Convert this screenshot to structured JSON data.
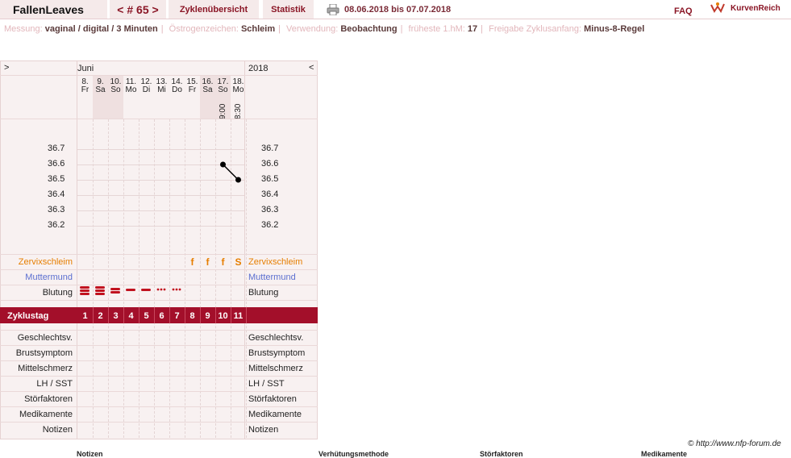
{
  "header": {
    "brand": "FallenLeaves",
    "cycle": "< # 65 >",
    "tab_overview": "Zyklenübersicht",
    "tab_stats": "Statistik",
    "date_range": "08.06.2018 bis 07.07.2018",
    "faq": "FAQ",
    "logo_text": "KurvenReich"
  },
  "meta": {
    "messung_label": "Messung:",
    "messung_value": "vaginal / digital / 3 Minuten",
    "oestrogen_label": "Östrogenzeichen:",
    "oestrogen_value": "Schleim",
    "verwendung_label": "Verwendung:",
    "verwendung_value": "Beobachtung",
    "frueheste_label": "früheste 1.hM:",
    "frueheste_value": "17",
    "freigabe_label": "Freigabe Zyklusanfang:",
    "freigabe_value": "Minus-8-Regel"
  },
  "chart_head": {
    "left_arrow": ">",
    "right_arrow": "<",
    "month": "Juni",
    "year": "2018"
  },
  "days": [
    {
      "num": "8.",
      "wd": "Fr"
    },
    {
      "num": "9.",
      "wd": "Sa"
    },
    {
      "num": "10.",
      "wd": "So"
    },
    {
      "num": "11.",
      "wd": "Mo"
    },
    {
      "num": "12.",
      "wd": "Di"
    },
    {
      "num": "13.",
      "wd": "Mi"
    },
    {
      "num": "14.",
      "wd": "Do"
    },
    {
      "num": "15.",
      "wd": "Fr"
    },
    {
      "num": "16.",
      "wd": "Sa"
    },
    {
      "num": "17.",
      "wd": "So"
    },
    {
      "num": "18.",
      "wd": "Mo"
    }
  ],
  "times": [
    {
      "day": "17.",
      "value": "9:00"
    },
    {
      "day": "18.",
      "value": "8:30"
    }
  ],
  "temperature_scale": [
    "36.7",
    "36.6",
    "36.5",
    "36.4",
    "36.3",
    "36.2"
  ],
  "chart_data": {
    "type": "line",
    "x": [
      "17.",
      "18."
    ],
    "series": [
      {
        "values": [
          36.6,
          36.5
        ]
      }
    ],
    "ylim": [
      36.2,
      36.7
    ]
  },
  "rows": {
    "zervix": "Zervixschleim",
    "muttermund": "Muttermund",
    "blutung": "Blutung",
    "zyklustag": "Zyklustag",
    "geschlechtsv": "Geschlechtsv.",
    "brustsymptom": "Brustsymptom",
    "mittelschmerz": "Mittelschmerz",
    "lh": "LH / SST",
    "stoerfaktoren": "Störfaktoren",
    "medikamente": "Medikamente",
    "notizen": "Notizen"
  },
  "zervix_marks": [
    "f",
    "f",
    "f",
    "S"
  ],
  "zyklustage": [
    "1",
    "2",
    "3",
    "4",
    "5",
    "6",
    "7",
    "8",
    "9",
    "10",
    "11"
  ],
  "footer": "© http://www.nfp-forum.de",
  "bottom_headings": [
    "Notizen",
    "Verhütungsmethode",
    "Störfaktoren",
    "Medikamente"
  ],
  "colors": {
    "accent": "#a30f2a",
    "orange": "#e67e00",
    "blue": "#5b6fd0"
  }
}
